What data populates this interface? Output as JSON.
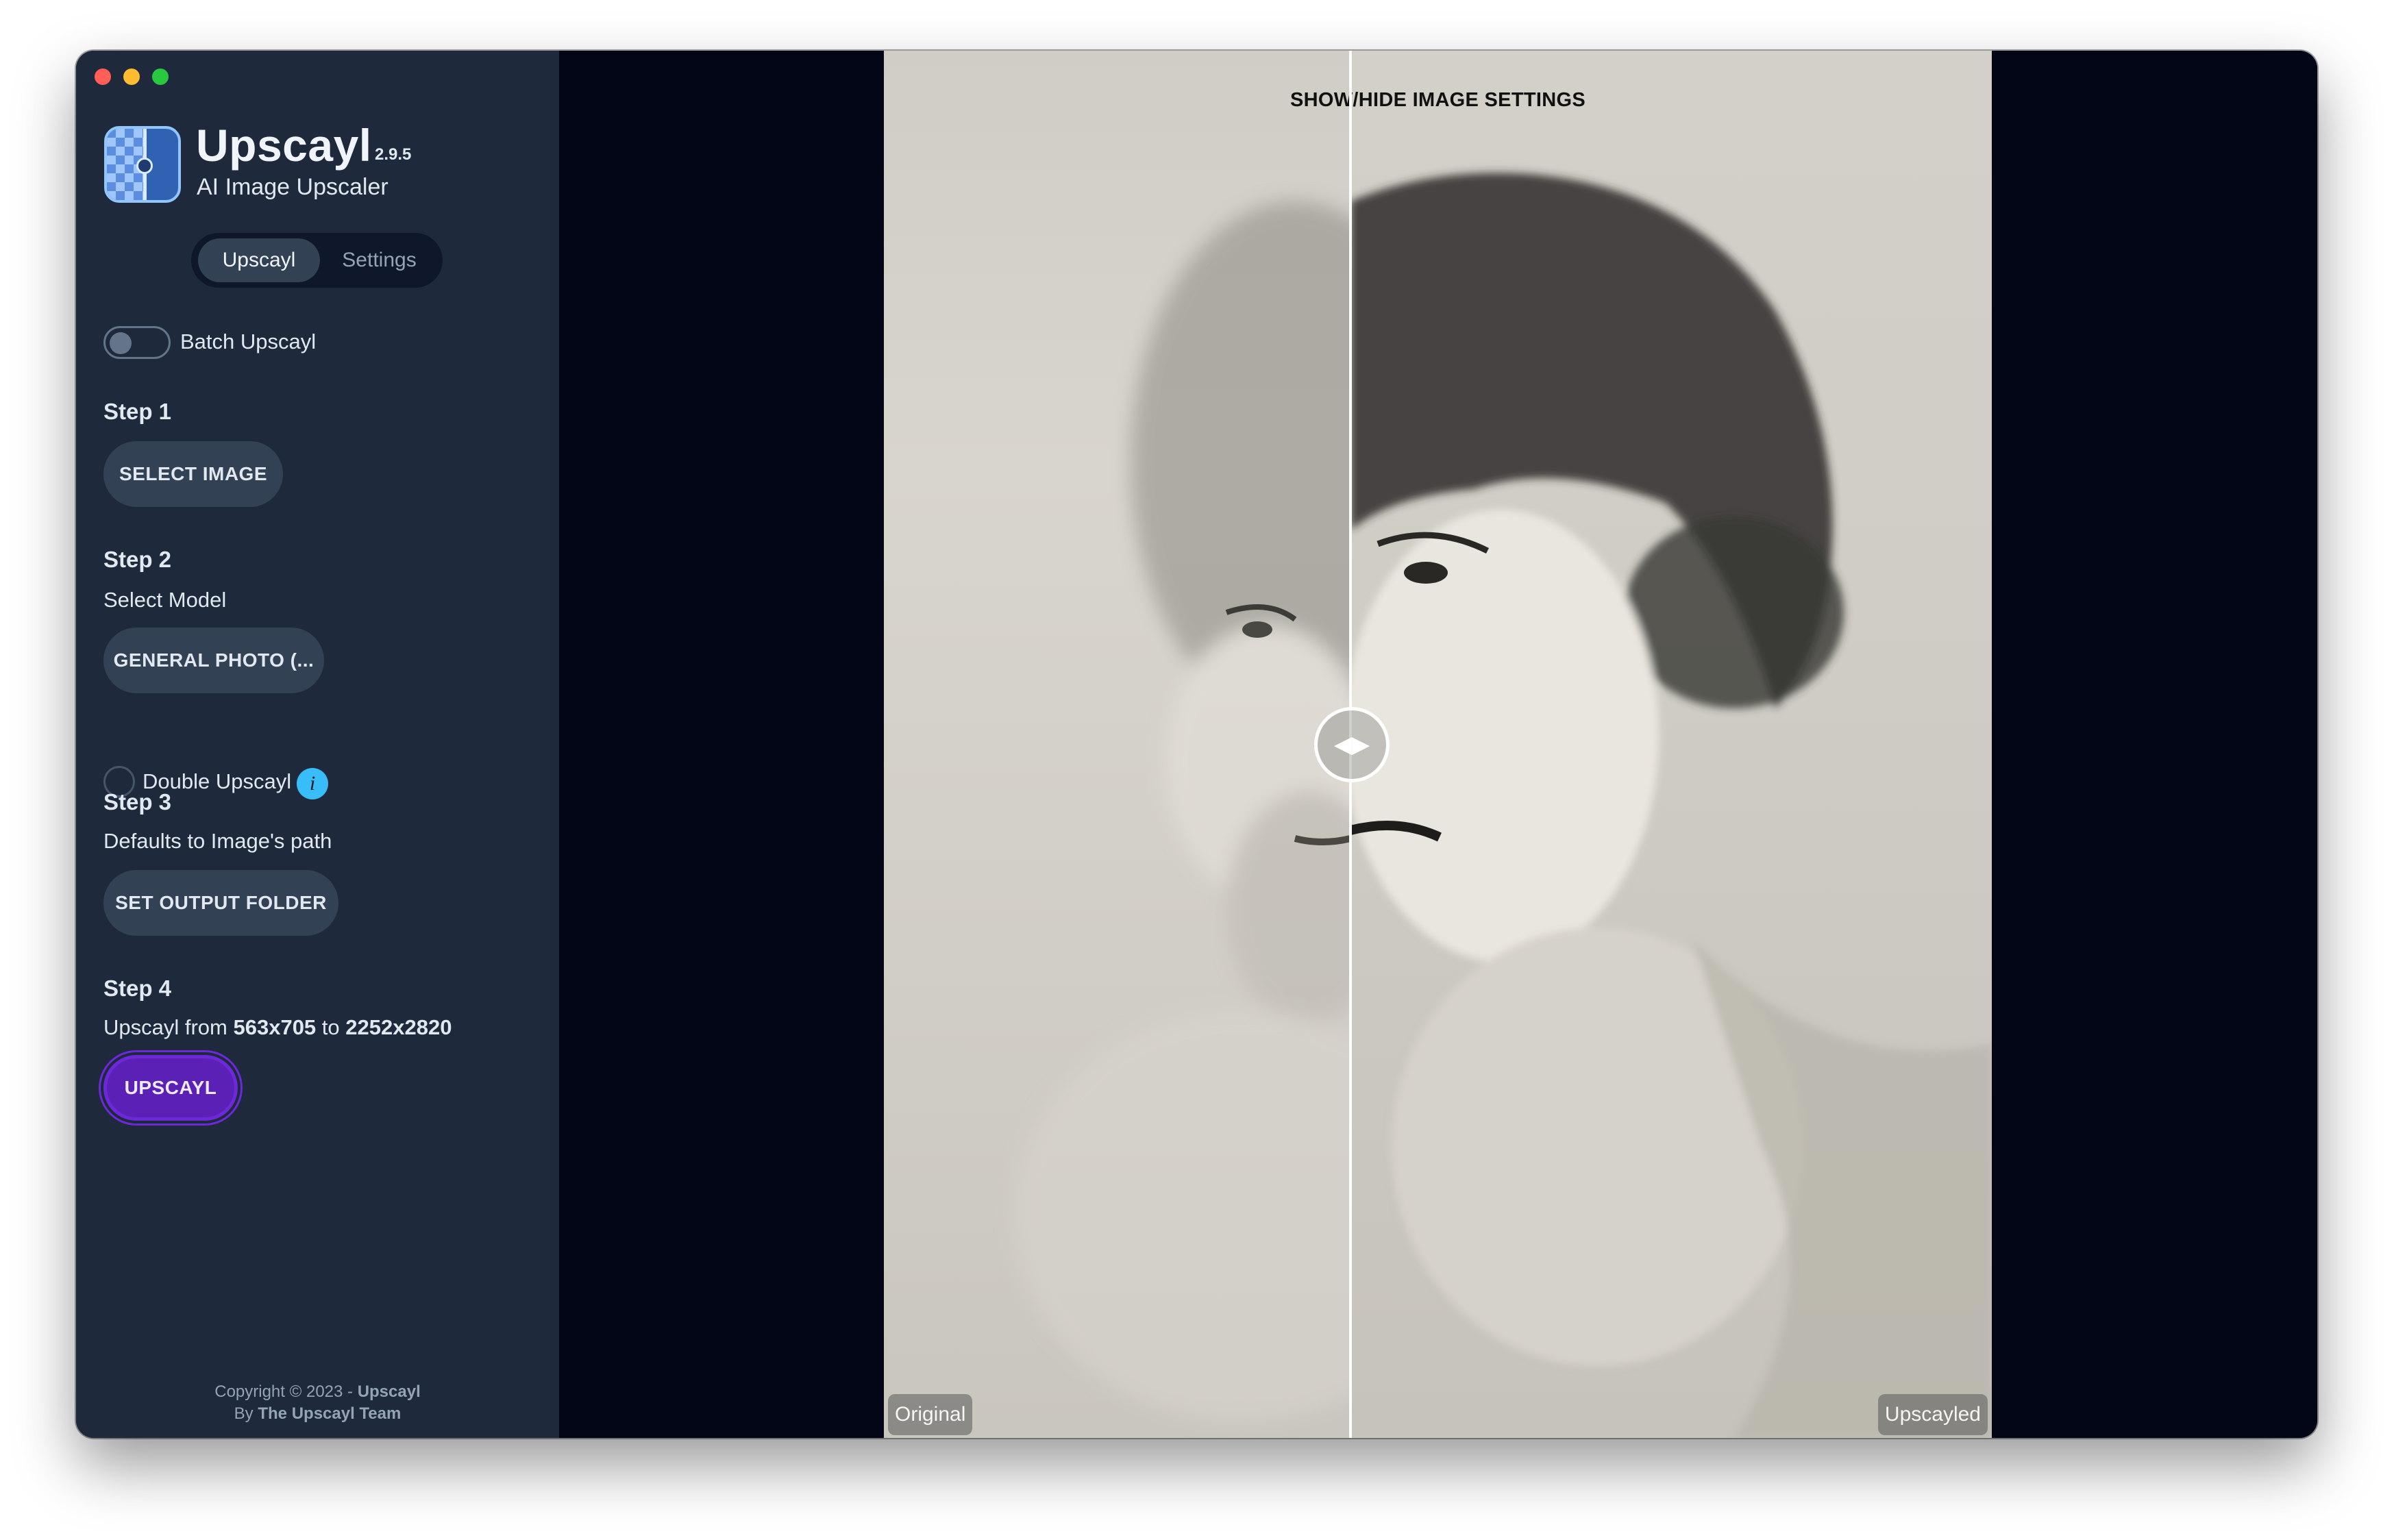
{
  "sidebar": {
    "app_name": "Upscayl",
    "version": "2.9.5",
    "subtitle": "AI Image Upscaler",
    "tabs": [
      {
        "label": "Upscayl",
        "active": true
      },
      {
        "label": "Settings",
        "active": false
      }
    ],
    "batch_label": "Batch Upscayl",
    "batch_enabled": false,
    "step1": {
      "title": "Step 1",
      "button": "SELECT IMAGE"
    },
    "step2": {
      "title": "Step 2",
      "subtitle": "Select Model",
      "model": "GENERAL PHOTO (...",
      "double_label": "Double Upscayl",
      "double_enabled": false,
      "info_icon": "i"
    },
    "step3": {
      "title": "Step 3",
      "subtitle": "Defaults to Image's path",
      "button": "SET OUTPUT FOLDER"
    },
    "step4": {
      "title": "Step 4",
      "prefix": "Upscayl from ",
      "from": "563x705",
      "mid": " to ",
      "to": "2252x2820",
      "button": "UPSCAYL"
    },
    "footer": {
      "line1_prefix": "Copyright © 2023 - ",
      "line1_brand": "Upscayl",
      "line2_prefix": "By ",
      "line2_team": "The Upscayl Team"
    }
  },
  "main": {
    "settings_toggle": "SHOW/HIDE IMAGE SETTINGS",
    "left_label": "Original",
    "right_label": "Upscayled",
    "slider_position": 0.42
  },
  "colors": {
    "sidebar_bg": "#1e293b",
    "main_bg": "#020617",
    "accent": "#5b21b6",
    "info": "#38bdf8"
  },
  "icons": [
    "close-dot-icon",
    "minimize-dot-icon",
    "maximize-dot-icon",
    "upscayl-logo-icon",
    "info-icon",
    "compare-arrows-icon"
  ]
}
